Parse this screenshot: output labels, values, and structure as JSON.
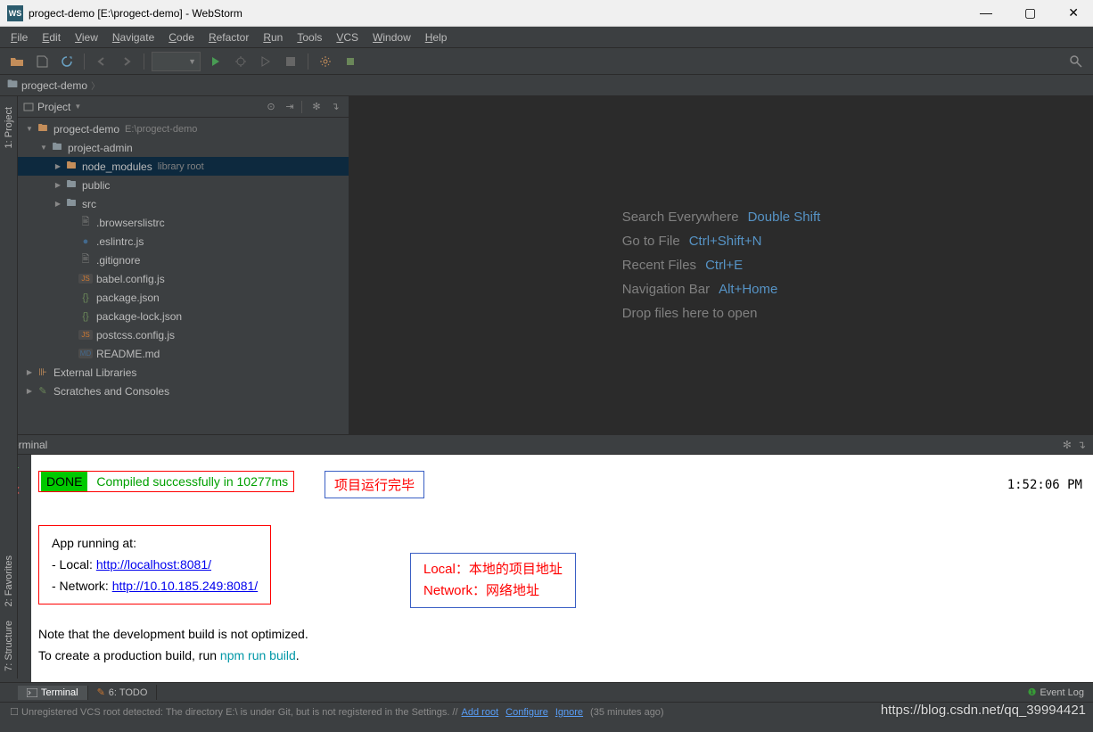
{
  "window": {
    "title": "progect-demo [E:\\progect-demo] - WebStorm",
    "icon_text": "WS"
  },
  "menus": [
    "File",
    "Edit",
    "View",
    "Navigate",
    "Code",
    "Refactor",
    "Run",
    "Tools",
    "VCS",
    "Window",
    "Help"
  ],
  "breadcrumb": {
    "item": "progect-demo"
  },
  "sidebar": {
    "header_label": "Project",
    "tree": [
      {
        "indent": 0,
        "arrow": "▼",
        "icon": "folder",
        "label": "progect-demo",
        "aux": "E:\\progect-demo",
        "color": "#c38d5a"
      },
      {
        "indent": 1,
        "arrow": "▼",
        "icon": "folder",
        "label": "project-admin",
        "color": "#87939a"
      },
      {
        "indent": 2,
        "arrow": "▶",
        "icon": "folder",
        "label": "node_modules",
        "aux": "library root",
        "color": "#c38d5a",
        "selected": true
      },
      {
        "indent": 2,
        "arrow": "▶",
        "icon": "folder",
        "label": "public",
        "color": "#87939a"
      },
      {
        "indent": 2,
        "arrow": "▶",
        "icon": "folder",
        "label": "src",
        "color": "#87939a"
      },
      {
        "indent": 3,
        "arrow": "",
        "icon": "file",
        "label": ".browserslistrc"
      },
      {
        "indent": 3,
        "arrow": "",
        "icon": "js-blue",
        "label": ".eslintrc.js"
      },
      {
        "indent": 3,
        "arrow": "",
        "icon": "file",
        "label": ".gitignore"
      },
      {
        "indent": 3,
        "arrow": "",
        "icon": "js",
        "label": "babel.config.js"
      },
      {
        "indent": 3,
        "arrow": "",
        "icon": "json",
        "label": "package.json"
      },
      {
        "indent": 3,
        "arrow": "",
        "icon": "json",
        "label": "package-lock.json"
      },
      {
        "indent": 3,
        "arrow": "",
        "icon": "js",
        "label": "postcss.config.js"
      },
      {
        "indent": 3,
        "arrow": "",
        "icon": "md",
        "label": "README.md"
      },
      {
        "indent": 0,
        "arrow": "▶",
        "icon": "lib",
        "label": "External Libraries"
      },
      {
        "indent": 0,
        "arrow": "▶",
        "icon": "scratch",
        "label": "Scratches and Consoles"
      }
    ]
  },
  "vtabs_left": [
    "1: Project"
  ],
  "vtabs_fav": [
    "2: Favorites",
    "7: Structure"
  ],
  "hints": [
    {
      "label": "Search Everywhere",
      "shortcut": "Double Shift"
    },
    {
      "label": "Go to File",
      "shortcut": "Ctrl+Shift+N"
    },
    {
      "label": "Recent Files",
      "shortcut": "Ctrl+E"
    },
    {
      "label": "Navigation Bar",
      "shortcut": "Alt+Home"
    },
    {
      "label": "Drop files here to open",
      "shortcut": ""
    }
  ],
  "terminal": {
    "title": "Terminal",
    "done": "DONE",
    "compiled": "Compiled successfully in 10277ms",
    "anno1": "项目运行完毕",
    "time": "1:52:06 PM",
    "app_title": "App running at:",
    "local_label": "- Local:   ",
    "local_url": "http://localhost:8081/",
    "net_label": "- Network: ",
    "net_url": "http://10.10.185.249:8081/",
    "anno2_line1": "Local：本地的项目地址",
    "anno2_line2": "Network：网络地址",
    "note1": "Note that the development build is not optimized.",
    "note2_pre": "To create a production build, run ",
    "note2_cmd": "npm run build",
    "note2_suf": "."
  },
  "bottom_tools": {
    "terminal_item": "Terminal",
    "todo_item": "6: TODO",
    "event_log": "Event Log"
  },
  "status": {
    "text": "Unregistered VCS root detected: The directory E:\\ is under Git, but is not registered in the Settings. // ",
    "link1": "Add root",
    "link2": "Configure",
    "link3": "Ignore",
    "suffix": "(35 minutes ago)"
  },
  "watermark": "https://blog.csdn.net/qq_39994421"
}
